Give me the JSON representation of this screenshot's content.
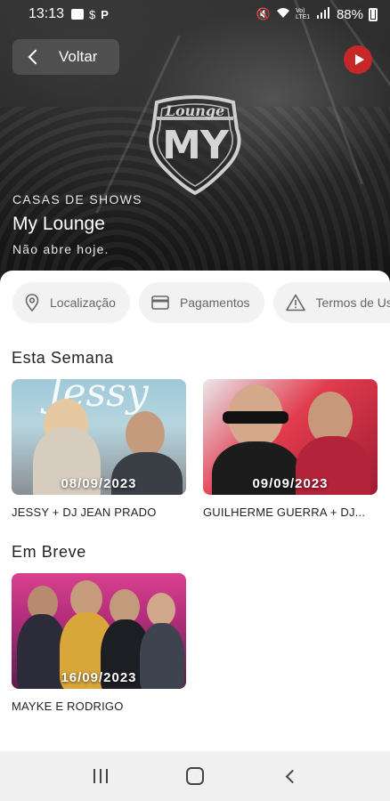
{
  "status_bar": {
    "time": "13:13",
    "network": "Vo) LTE1",
    "battery": "88%"
  },
  "header": {
    "back_label": "Voltar",
    "logo_text_top": "Lounge",
    "logo_text_main": "MY",
    "category": "CASAS DE SHOWS",
    "venue_name": "My Lounge",
    "venue_status": "Não abre hoje."
  },
  "chips": [
    {
      "label": "Localização",
      "icon": "location-pin-icon"
    },
    {
      "label": "Pagamentos",
      "icon": "credit-card-icon"
    },
    {
      "label": "Termos de Uso",
      "icon": "warning-icon"
    }
  ],
  "sections": {
    "this_week": {
      "title": "Esta Semana",
      "events": [
        {
          "date": "08/09/2023",
          "title": "JESSY + DJ JEAN PRADO",
          "poster_text": "Jessy"
        },
        {
          "date": "09/09/2023",
          "title": "GUILHERME GUERRA + DJ..."
        }
      ]
    },
    "coming_soon": {
      "title": "Em Breve",
      "events": [
        {
          "date": "16/09/2023",
          "title": "MAYKE E RODRIGO"
        }
      ]
    }
  },
  "colors": {
    "youtube_red": "#c62828",
    "chip_bg": "#f2f2f2",
    "nav_bg": "#f0f0f0"
  }
}
